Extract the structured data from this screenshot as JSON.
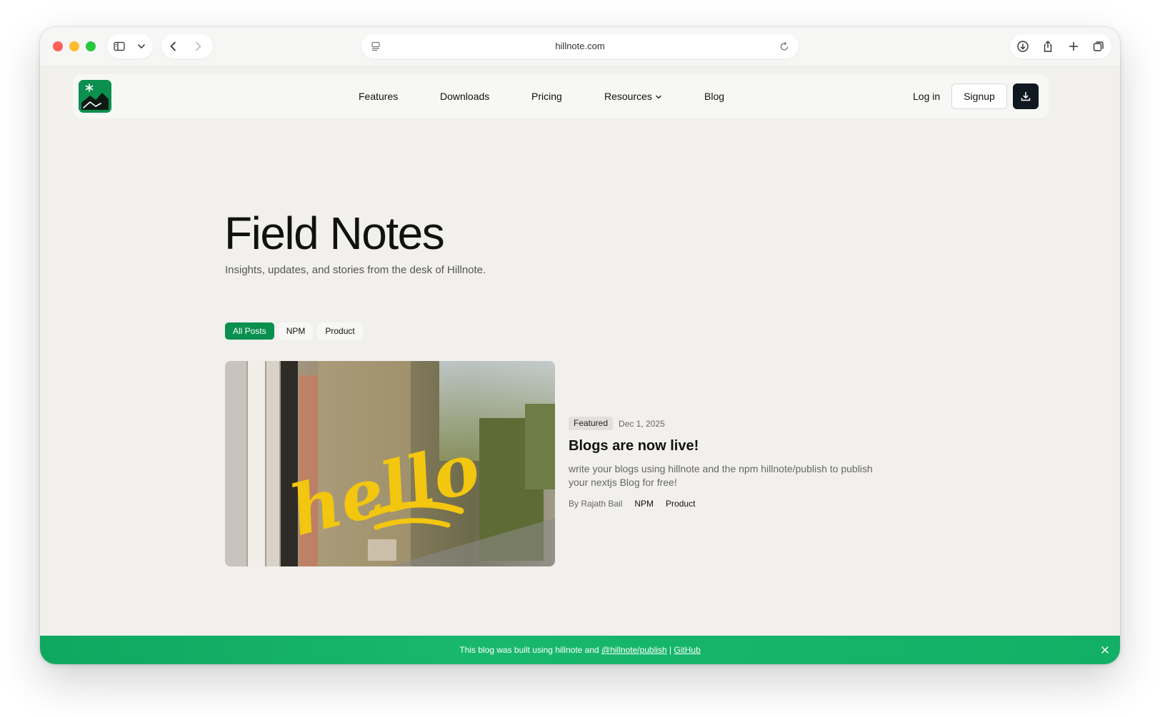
{
  "browser": {
    "url": "hillnote.com",
    "icons": {
      "sidebar": "sidebar-icon",
      "chevron": "chevron-down-icon",
      "back": "back-icon",
      "forward": "forward-icon",
      "page": "page-menu-icon",
      "reload": "reload-icon",
      "downloads": "download-icon",
      "share": "share-icon",
      "new_tab": "plus-icon",
      "tabs": "tab-overview-icon"
    }
  },
  "nav": {
    "links": [
      "Features",
      "Downloads",
      "Pricing",
      "Resources",
      "Blog"
    ],
    "login": "Log in",
    "signup": "Signup",
    "brand_color": "#0a8f4f"
  },
  "hero": {
    "title": "Field Notes",
    "subtitle": "Insights, updates, and stories from the desk of Hillnote."
  },
  "filters": [
    {
      "label": "All Posts",
      "active": true
    },
    {
      "label": "NPM",
      "active": false
    },
    {
      "label": "Product",
      "active": false
    }
  ],
  "post": {
    "image_text": "hello",
    "badge": "Featured",
    "date": "Dec 1, 2025",
    "title": "Blogs are now live!",
    "excerpt": "write your blogs using hillnote and the npm hillnote/publish to publish your nextjs Blog for free!",
    "author": "By Rajath Bail",
    "tags": [
      "NPM",
      "Product"
    ]
  },
  "banner": {
    "prefix": "This blog was built using hillnote and ",
    "link": "@hillnote/publish",
    "separator": " | ",
    "github": "GitHub",
    "color": "#12b066"
  }
}
